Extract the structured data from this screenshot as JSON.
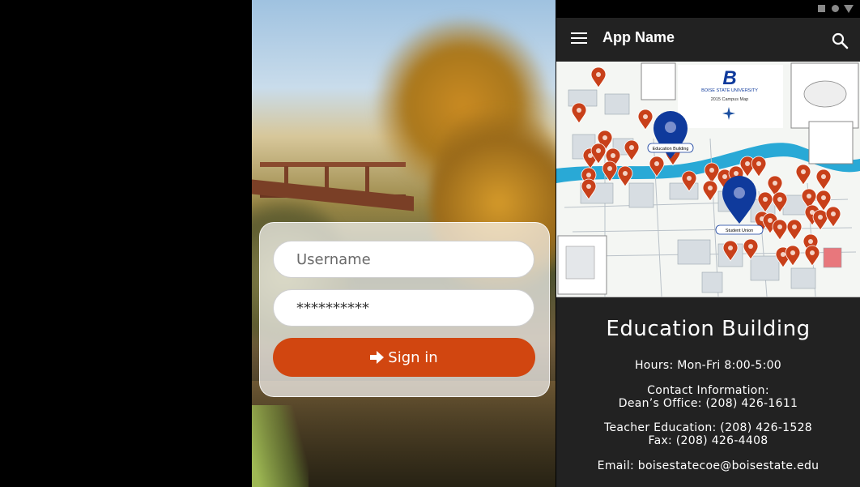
{
  "login": {
    "username_placeholder": "Username",
    "password_value": "**********",
    "signin_label": "Sign in",
    "signin_icon": "sign-in-arrow-icon",
    "accent_color": "#d14610"
  },
  "app": {
    "title": "App Name",
    "menu_icon": "hamburger-menu-icon",
    "search_icon": "search-icon",
    "status_icons": [
      "square-icon",
      "circle-icon",
      "triangle-down-icon"
    ]
  },
  "map": {
    "university": "BOISE STATE UNIVERSITY",
    "map_title": "2015 Campus Map",
    "logo_letter": "B",
    "selected_markers": [
      {
        "label": "Education Building"
      },
      {
        "label": "Student Union"
      }
    ],
    "marker_color": "#c8401a",
    "selected_marker_color": "#0f3a9c",
    "river_color": "#29a9d6"
  },
  "building": {
    "name": "Education Building",
    "hours": "Hours: Mon-Fri 8:00-5:00",
    "contact_heading": "Contact Information:",
    "deans_office": "Dean’s Office: (208) 426-1611",
    "teacher_education": "Teacher Education: (208) 426-1528",
    "fax": "Fax: (208) 426-4408",
    "email": "Email: boisestatecoe@boisestate.edu"
  }
}
